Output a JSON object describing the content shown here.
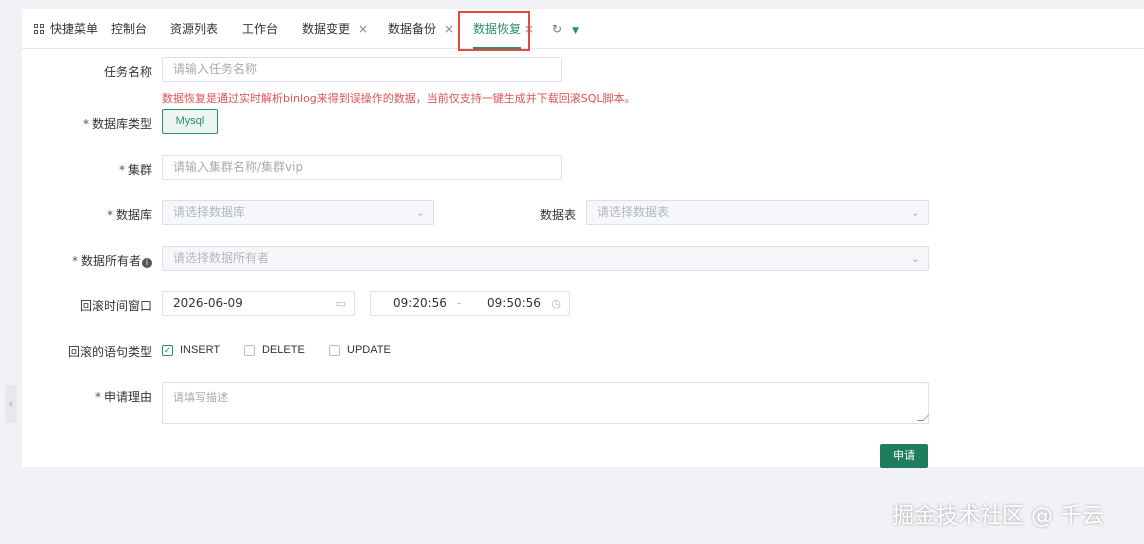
{
  "tabs": {
    "quick_menu": "快捷菜单",
    "items": [
      {
        "label": "控制台",
        "closable": false
      },
      {
        "label": "资源列表",
        "closable": false
      },
      {
        "label": "工作台",
        "closable": false
      },
      {
        "label": "数据变更",
        "closable": true
      },
      {
        "label": "数据备份",
        "closable": true
      },
      {
        "label": "数据恢复",
        "closable": true,
        "active": true
      }
    ],
    "close_glyph": "×"
  },
  "form": {
    "task_name": {
      "label": "任务名称",
      "placeholder": "请输入任务名称"
    },
    "hint": "数据恢复是通过实时解析binlog来得到误操作的数据，当前仅支持一键生成并下载回滚SQL脚本。",
    "db_type": {
      "label": "数据库类型",
      "value": "Mysql"
    },
    "cluster": {
      "label": "集群",
      "placeholder": "请输入集群名称/集群vip"
    },
    "database": {
      "label": "数据库",
      "placeholder": "请选择数据库"
    },
    "table": {
      "label": "数据表",
      "placeholder": "请选择数据表"
    },
    "owner": {
      "label": "数据所有者",
      "placeholder": "请选择数据所有者"
    },
    "window": {
      "label": "回滚时间窗口",
      "date": "2026-06-09",
      "start_time": "09:20:56",
      "separator": "-",
      "end_time": "09:50:56"
    },
    "stmt_types": {
      "label": "回滚的语句类型",
      "options": [
        {
          "label": "INSERT",
          "checked": true
        },
        {
          "label": "DELETE",
          "checked": false
        },
        {
          "label": "UPDATE",
          "checked": false
        }
      ]
    },
    "reason": {
      "label": "申请理由",
      "placeholder": "请填写描述"
    },
    "required_mark": "*",
    "submit": "申请"
  },
  "watermark": "掘金技术社区 @ 千云",
  "colors": {
    "accent": "#2b8f6a",
    "primary_button": "#1e7d5a",
    "hint": "#e05252",
    "highlight_box": "#e34a3c"
  }
}
